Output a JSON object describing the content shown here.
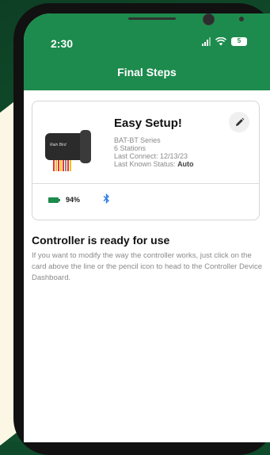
{
  "status_bar": {
    "time": "2:30",
    "battery": "5"
  },
  "header": {
    "title": "Final Steps"
  },
  "card": {
    "name": "Easy Setup!",
    "series": "BAT-BT Series",
    "stations": "6 Stations",
    "last_connect": "Last Connect: 12/13/23",
    "last_status_label": "Last Known Status:",
    "last_status_value": "Auto",
    "battery_percent": "94%",
    "device_logo": "Rain Bird",
    "icons": [
      "pencil-icon",
      "battery-icon",
      "bluetooth-icon"
    ]
  },
  "main": {
    "heading": "Controller is ready for use",
    "description": "If you want to modify the way the controller works, just click on the card above the line or the pencil icon to head to the Controller Device Dashboard."
  },
  "colors": {
    "brand_green": "#1d8b4d",
    "bluetooth": "#2f7de1"
  }
}
